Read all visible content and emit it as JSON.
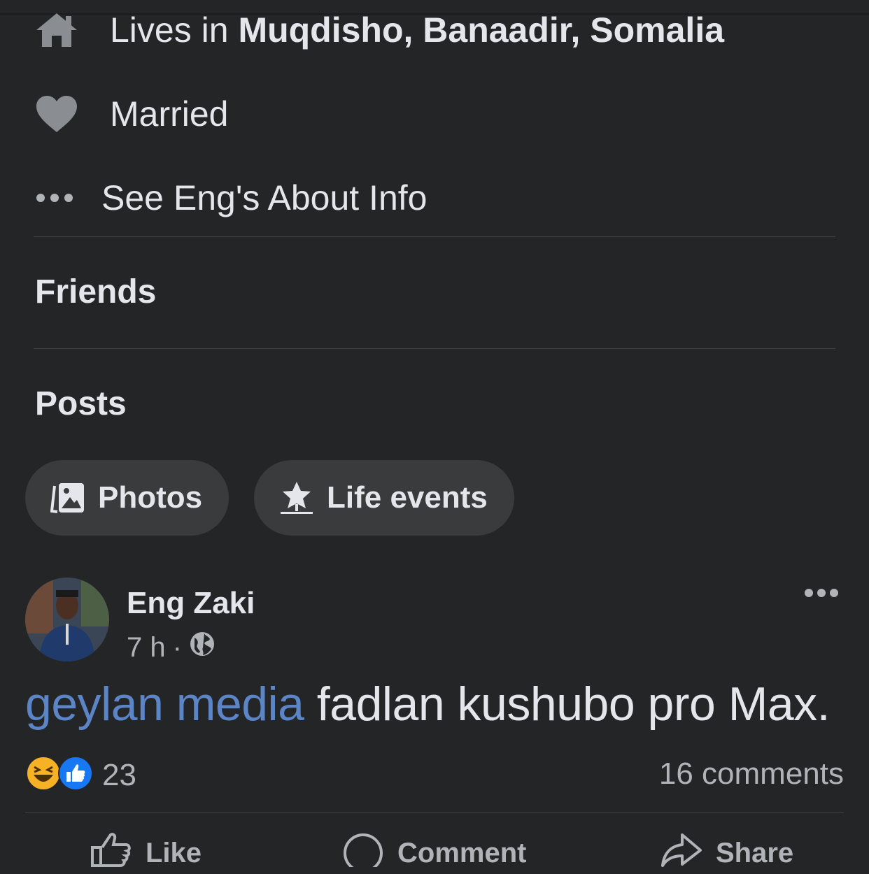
{
  "about": {
    "lives_prefix": "Lives in ",
    "lives_place": "Muqdisho, Banaadir, Somalia",
    "relationship": "Married",
    "see_about": "See Eng's About Info"
  },
  "sections": {
    "friends": "Friends",
    "posts": "Posts"
  },
  "chips": {
    "photos": "Photos",
    "life_events": "Life events"
  },
  "post": {
    "author": "Eng Zaki",
    "time": "7 h",
    "separator": "·",
    "mention": "geylan media",
    "text": "fadlan kushubo pro Max.",
    "reaction_count": "23",
    "comments": "16 comments"
  },
  "actions": {
    "like": "Like",
    "comment": "Comment",
    "share": "Share"
  },
  "colors": {
    "background": "#242527",
    "chip": "#3a3b3c",
    "mention": "#5b85c6",
    "like_blue": "#1877f2"
  }
}
